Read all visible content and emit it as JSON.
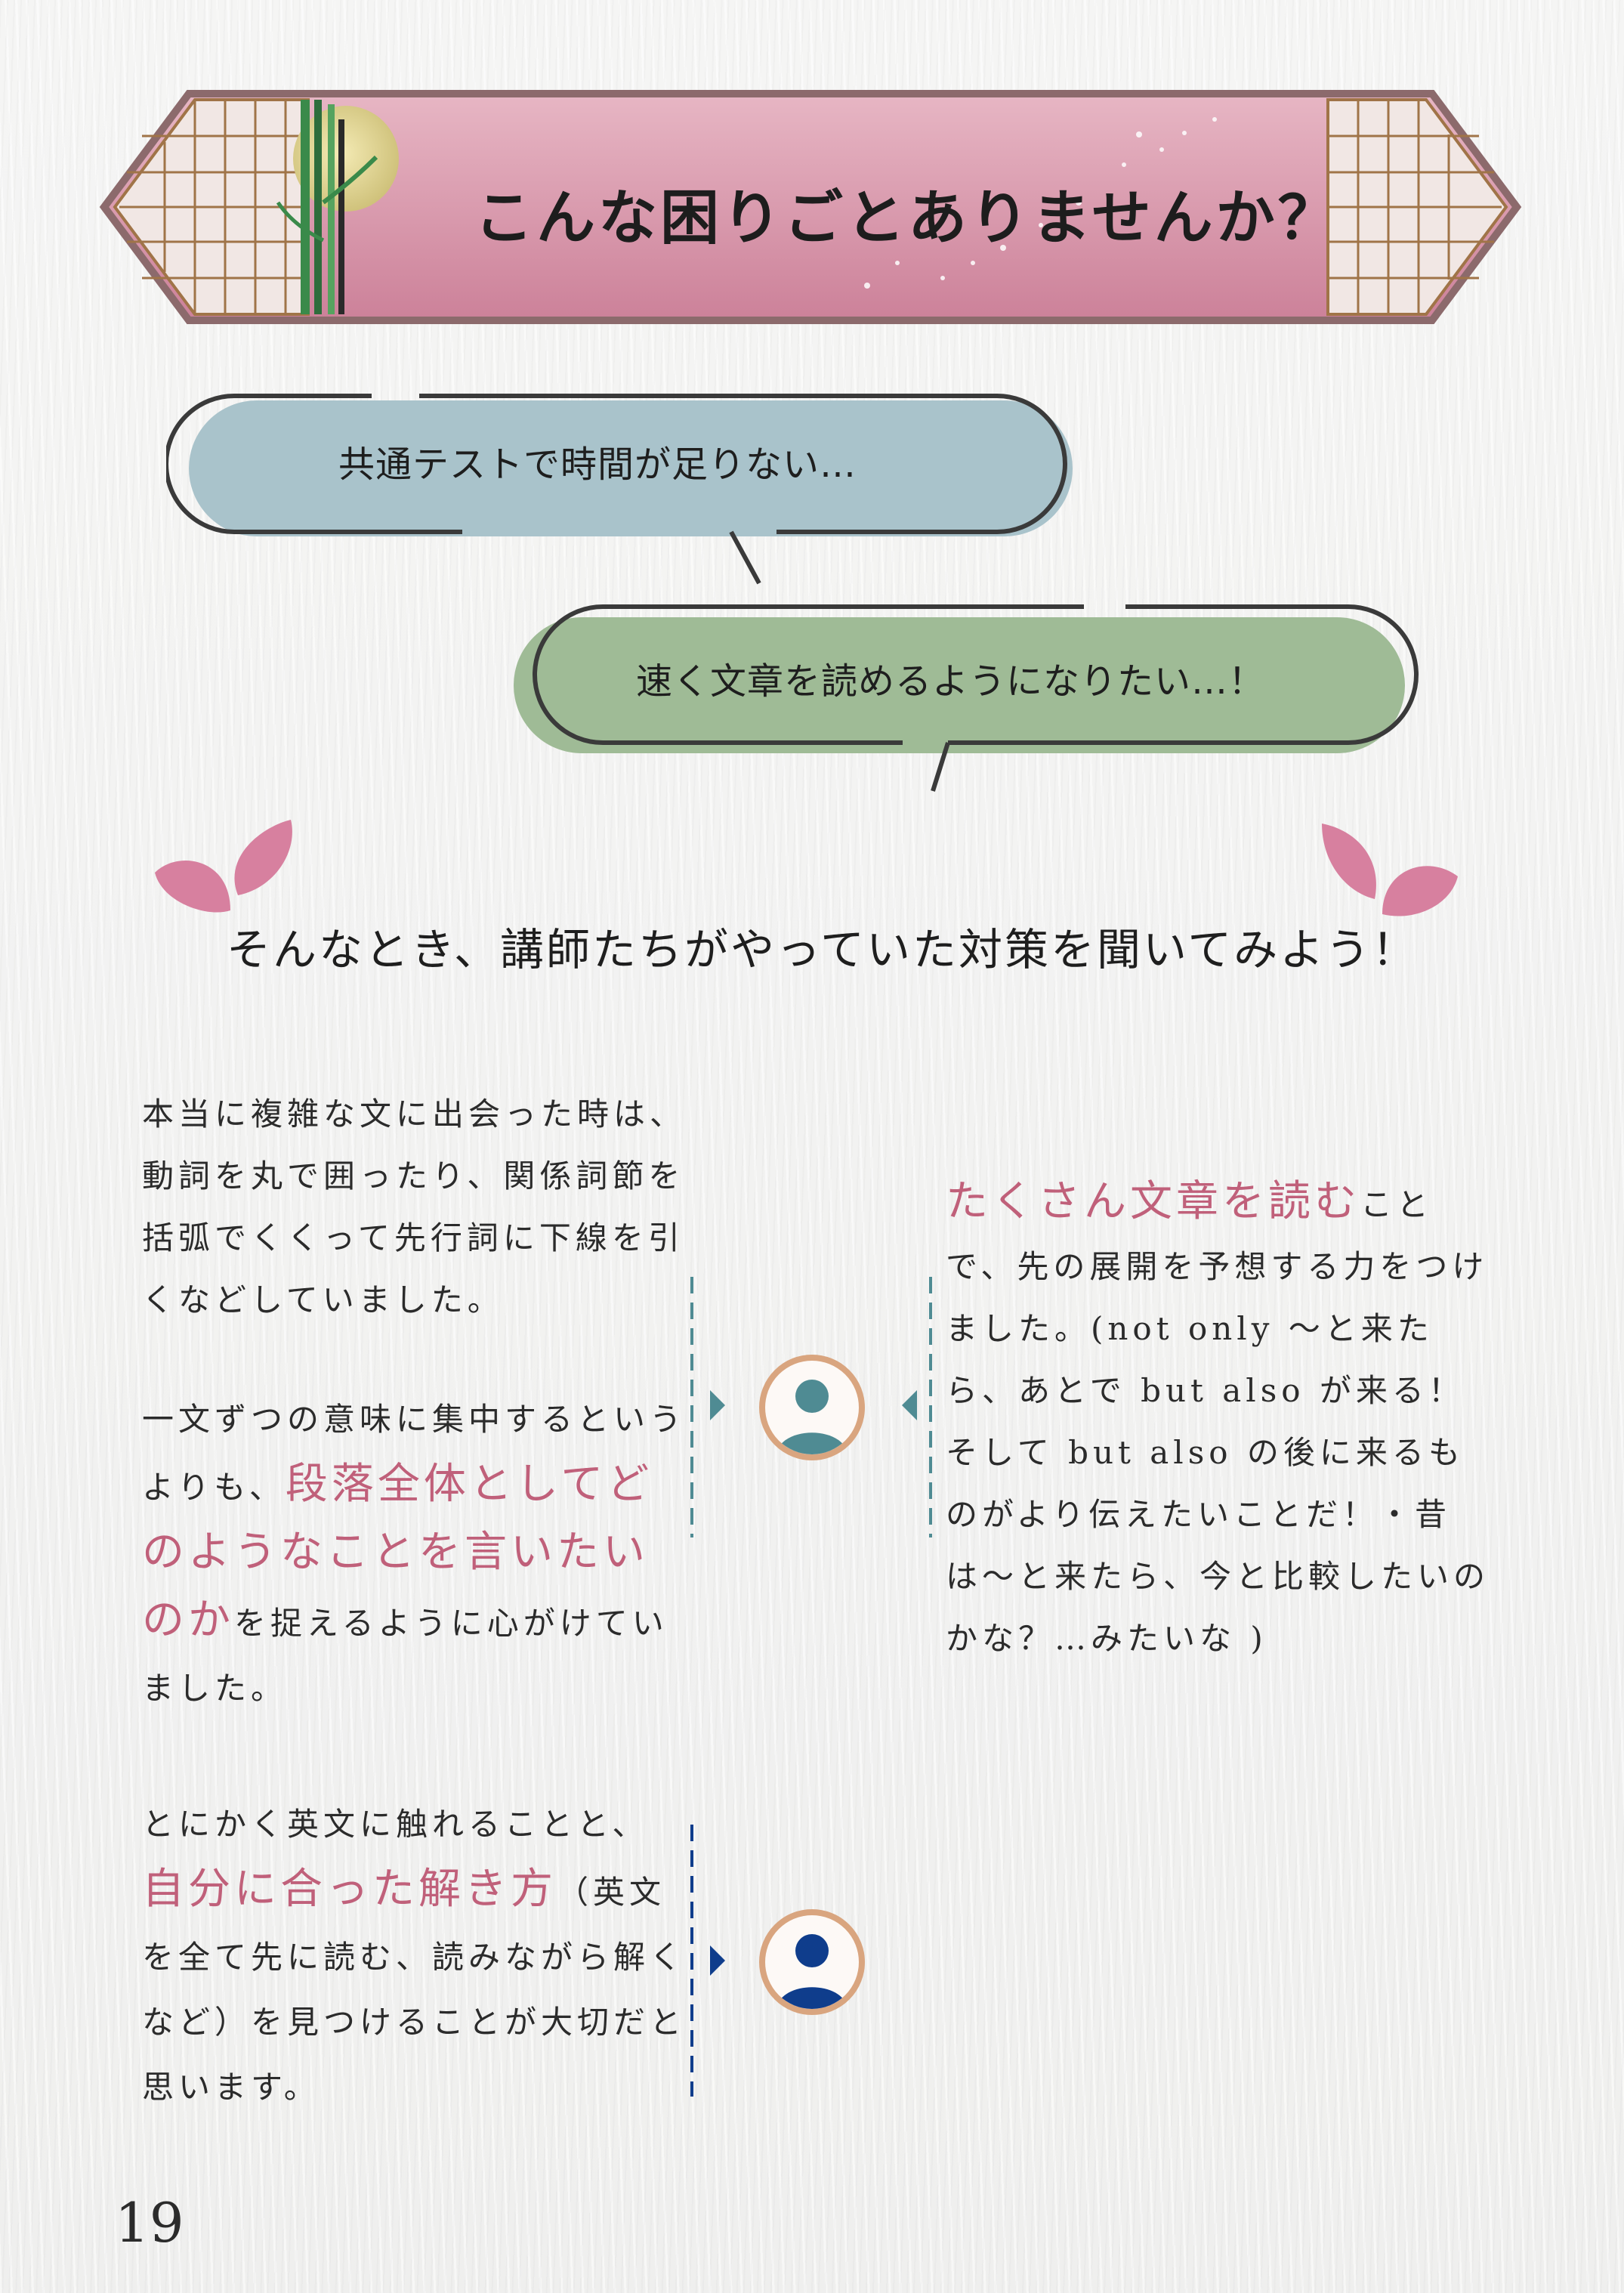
{
  "banner": {
    "title": "こんな困りごとありませんか？"
  },
  "bubbles": [
    {
      "text": "共通テストで時間が足りない…"
    },
    {
      "text": "速く文章を読めるようになりたい…！"
    }
  ],
  "heading": "そんなとき、講師たちがやっていた対策を聞いてみよう！",
  "advice": {
    "teacher1_p1": "本当に複雑な文に出会った時は、動詞を丸で囲ったり、関係詞節を括弧でくくって先行詞に下線を引くなどしていました。",
    "teacher1_p2_pre": "一文ずつの意味に集中するというよりも、",
    "teacher1_p2_hl": "段落全体としてどのようなことを言いたいのか",
    "teacher1_p2_post": "を捉えるように心がけていました。",
    "teacher2_hl": "たくさん文章を読む",
    "teacher2_post": "ことで、先の展開を予想する力をつけました。(not only 〜と来たら、あとで but also が来る！そして but also の後に来るものがより伝えたいことだ！・昔は〜と来たら、今と比較したいのかな？…みたいな )",
    "teacher3_pre": "とにかく英文に触れることと、",
    "teacher3_hl": "自分に合った解き方",
    "teacher3_post": "（英文を全て先に読む、読みながら解くなど）を見つけることが大切だと思います。"
  },
  "page_number": "19",
  "colors": {
    "accent_pink": "#c0607a",
    "bubble_blue": "#a9c3cb",
    "bubble_green": "#9fbb96",
    "avatar_teal": "#4f8b93",
    "avatar_navy": "#0f3d8c",
    "avatar_ring": "#d9a57f"
  }
}
